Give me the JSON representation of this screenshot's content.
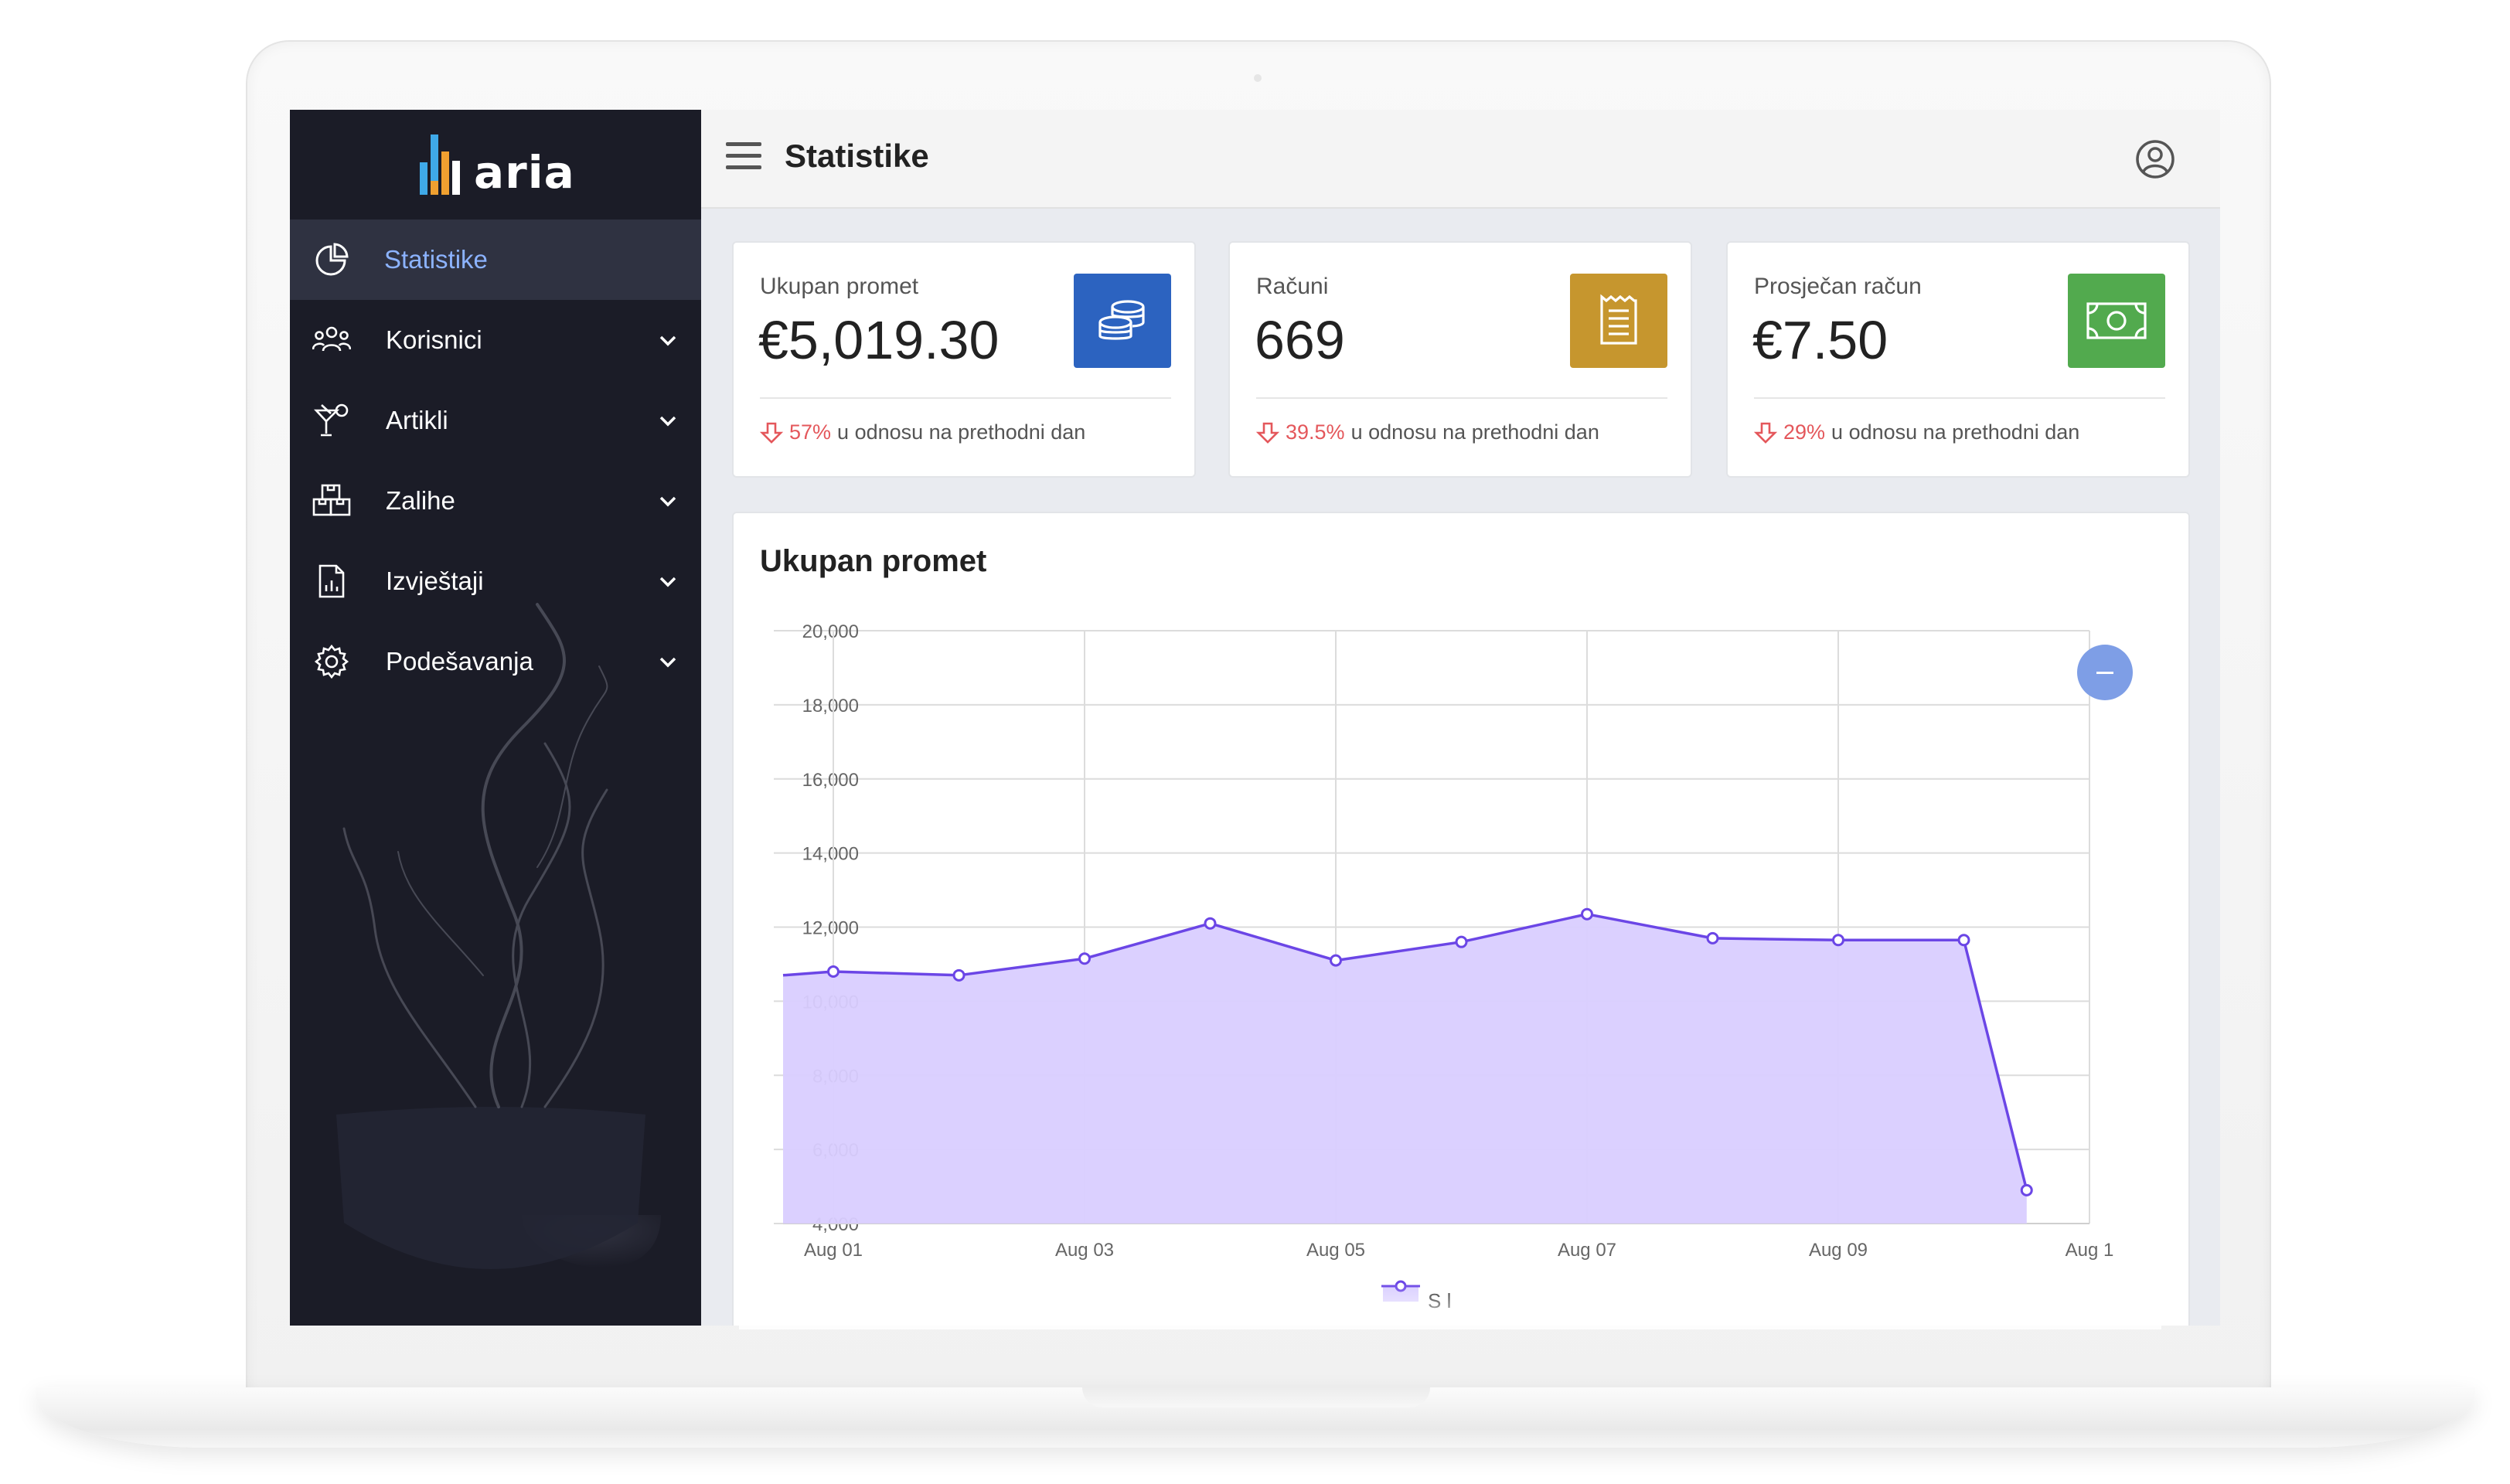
{
  "app": {
    "logo_text": "aria",
    "page_title": "Statistike"
  },
  "sidebar": {
    "items": [
      {
        "label": "Statistike",
        "icon": "pie-chart-icon",
        "active": true
      },
      {
        "label": "Korisnici",
        "icon": "users-icon"
      },
      {
        "label": "Artikli",
        "icon": "cocktail-icon"
      },
      {
        "label": "Zalihe",
        "icon": "boxes-icon"
      },
      {
        "label": "Izvještaji",
        "icon": "report-icon"
      },
      {
        "label": "Podešavanja",
        "icon": "gear-icon"
      }
    ]
  },
  "stats": [
    {
      "label": "Ukupan promet",
      "value": "€5,019.30",
      "change": "57%",
      "change_text": "u odnosu na prethodni dan",
      "color": "#2c63c0",
      "icon": "coins-icon"
    },
    {
      "label": "Računi",
      "value": "669",
      "change": "39.5%",
      "change_text": "u odnosu na prethodni dan",
      "color": "#c6962e",
      "icon": "receipt-icon"
    },
    {
      "label": "Prosječan račun",
      "value": "€7.50",
      "change": "29%",
      "change_text": "u odnosu na prethodni dan",
      "color": "#52aa4e",
      "icon": "banknote-icon"
    }
  ],
  "chart_data": {
    "type": "area",
    "title": "Ukupan promet",
    "x_tick_labels": [
      "Aug 01",
      "Aug 03",
      "Aug 05",
      "Aug 07",
      "Aug 09",
      "Aug 1"
    ],
    "y_tick_labels": [
      "20,000",
      "18,000",
      "16,000",
      "14,000",
      "12,000",
      "10,000",
      "8,000",
      "6,000",
      "4,000"
    ],
    "ylim": [
      4000,
      20000
    ],
    "x_day_range": [
      31.6,
      42.0
    ],
    "series": [
      {
        "x_day": [
          32,
          33,
          34,
          35,
          36,
          37,
          38,
          39,
          40,
          41
        ],
        "values": [
          10800,
          10700,
          11150,
          12100,
          11100,
          11600,
          12350,
          11700,
          11650,
          11650
        ],
        "left_edge_value": 10700,
        "last_x_day": 41.5,
        "last_value": 4900
      }
    ],
    "line_color": "#6b46e6",
    "fill_color": "#d9ceff",
    "legend_partial": "S l",
    "grid": true
  }
}
